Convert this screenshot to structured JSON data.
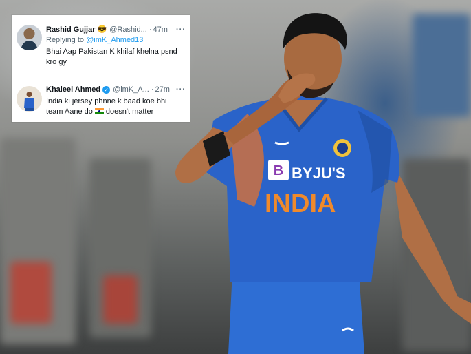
{
  "tweets": [
    {
      "name": "Rashid Gujjar",
      "emoji": "😎",
      "handle": "@Rashid...",
      "dot": "·",
      "time": "47m",
      "more": "···",
      "reply_prefix": "Replying to ",
      "reply_handle": "@imK_Ahmed13",
      "text": "Bhai Aap Pakistan K khilaf khelna psnd kro gy"
    },
    {
      "name": "Khaleel Ahmed",
      "handle": "@imK_A...",
      "dot": "·",
      "time": "27m",
      "more": "···",
      "text_before_flag": "India ki jersey phnne k baad koe bhi team Aane do",
      "text_after_flag": "doesn't matter"
    }
  ],
  "jersey": {
    "brand": "BYJU'S",
    "brand_mark": "B",
    "country": "INDIA"
  },
  "colors": {
    "jersey_blue": "#2a63c9",
    "accent_orange": "#f08a2b",
    "twitter_blue": "#1d9bf0"
  },
  "icons": [
    "verified-badge-icon",
    "india-flag-icon",
    "more-options-icon",
    "sunglasses-emoji-icon"
  ]
}
